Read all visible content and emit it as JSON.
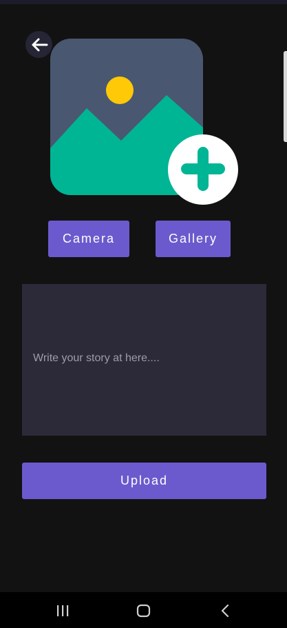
{
  "colors": {
    "background": "#121212",
    "accent": "#6b5acd",
    "input_background": "#2c2a39",
    "placeholder_text": "#9e9cab",
    "image_icon_sky": "#4a5770",
    "image_icon_hills": "#00b594",
    "image_icon_sun": "#ffc907"
  },
  "header": {
    "back_icon": "arrow-left-icon"
  },
  "image_picker": {
    "icon": "image-add-icon"
  },
  "actions": {
    "camera_label": "Camera",
    "gallery_label": "Gallery"
  },
  "story": {
    "placeholder": "Write your story at here...."
  },
  "upload": {
    "label": "Upload"
  },
  "system_nav": {
    "recents_icon": "recent-apps-icon",
    "home_icon": "home-icon",
    "back_icon": "back-chevron-icon"
  }
}
